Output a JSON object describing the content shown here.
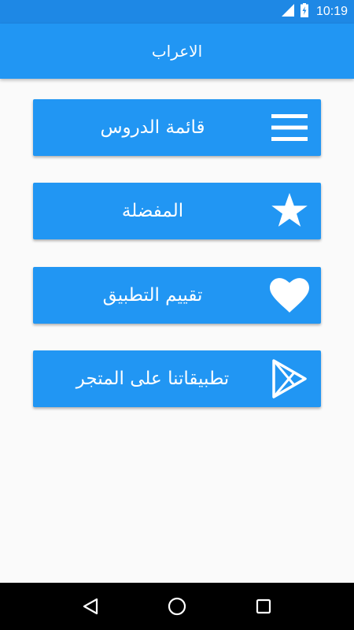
{
  "status_bar": {
    "time": "10:19",
    "icons": [
      "signal-icon",
      "battery-icon"
    ]
  },
  "app_bar": {
    "title": "الاعراب"
  },
  "menu": [
    {
      "label": "قائمة الدروس",
      "icon": "menu-list-icon"
    },
    {
      "label": "المفضلة",
      "icon": "star-icon"
    },
    {
      "label": "تقييم التطبيق",
      "icon": "heart-icon"
    },
    {
      "label": "تطبيقاتنا على المتجر",
      "icon": "play-store-icon"
    }
  ],
  "nav_bar": {
    "icons": [
      "back-icon",
      "home-icon",
      "recents-icon"
    ]
  },
  "colors": {
    "status_bar": "#1e88e5",
    "app_bar": "#2196f3",
    "button": "#2196f3",
    "background": "#fafafa",
    "nav_bar": "#000000"
  }
}
